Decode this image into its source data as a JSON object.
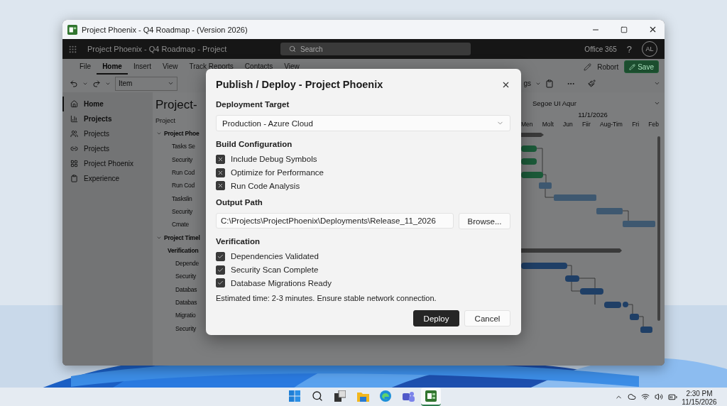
{
  "window": {
    "title": "Project Phoenix - Q4 Roadmap - (Version 2026)"
  },
  "app_bar": {
    "title": "Project Phoenix - Q4 Roadmap - Project",
    "search": {
      "placeholder": "Search"
    },
    "product": "Office 365",
    "help": "?",
    "avatar": "AL"
  },
  "ribbon": {
    "tabs": [
      {
        "label": "File",
        "selected": false
      },
      {
        "label": "Home",
        "selected": true
      },
      {
        "label": "Insert",
        "selected": false
      },
      {
        "label": "View",
        "selected": false
      },
      {
        "label": "Track Reports",
        "selected": false
      },
      {
        "label": "Contacts",
        "selected": false
      },
      {
        "label": "View",
        "selected": false
      }
    ],
    "user": "Robort",
    "save": "Save"
  },
  "toolbar": {
    "item_select": "Item",
    "partial_label": "gs",
    "font_select": "Segoe UI Aqur"
  },
  "sidebar": {
    "items": [
      {
        "label": "Home",
        "selected": true,
        "bold": true
      },
      {
        "label": "Projects",
        "selected": false,
        "bold": true
      },
      {
        "label": "Projects",
        "selected": false,
        "bold": false
      },
      {
        "label": "Projects",
        "selected": false,
        "bold": false
      },
      {
        "label": "Project Phoenix",
        "selected": false,
        "bold": false
      },
      {
        "label": "Experience",
        "selected": false,
        "bold": false
      }
    ]
  },
  "outline": {
    "title": "Project-",
    "column": "Project",
    "rows": [
      {
        "label": "Project Phoe",
        "expanded": true,
        "children": [
          {
            "label": "Tasks Se"
          },
          {
            "label": "Security"
          },
          {
            "label": "Run Cod"
          },
          {
            "label": "Run Cod"
          },
          {
            "label": "Taskslin"
          },
          {
            "label": "Security"
          },
          {
            "label": "Cmate"
          }
        ]
      },
      {
        "label": "Project Timel",
        "expanded": true,
        "children": [
          {
            "label": "Verification",
            "children": [
              {
                "label": "Depende"
              },
              {
                "label": "Security"
              },
              {
                "label": "Databas"
              },
              {
                "label": "Databas"
              },
              {
                "label": "Migratio"
              },
              {
                "label": "Security"
              }
            ]
          }
        ]
      }
    ]
  },
  "gantt": {
    "date": "11/1/2026",
    "periods": [
      "Men",
      "Molt",
      "Jun",
      "Fiir",
      "Aug-Tim",
      "Fri",
      "Feb"
    ]
  },
  "dialog": {
    "title": "Publish / Deploy - Project Phoenix",
    "target": {
      "label": "Deployment Target",
      "value": "Production - Azure Cloud"
    },
    "build": {
      "label": "Build Configuration",
      "options": [
        {
          "label": "Include Debug Symbols",
          "checked": true,
          "kind": "cross"
        },
        {
          "label": "Optimize for Performance",
          "checked": true,
          "kind": "cross"
        },
        {
          "label": "Run Code Analysis",
          "checked": true,
          "kind": "cross"
        }
      ]
    },
    "output": {
      "label": "Output Path",
      "value": "C:\\Projects\\ProjectPhoenix\\Deployments\\Release_11_2026",
      "browse": "Browse..."
    },
    "verification": {
      "label": "Verification",
      "options": [
        {
          "label": "Dependencies Validated",
          "checked": true,
          "kind": "tick"
        },
        {
          "label": "Security Scan Complete",
          "checked": true,
          "kind": "tick"
        },
        {
          "label": "Database Migrations Ready",
          "checked": true,
          "kind": "tick"
        }
      ]
    },
    "note": "Estimated time: 2-3 minutes. Ensure stable network connection.",
    "buttons": [
      {
        "label": "Deploy",
        "kind": "primary"
      },
      {
        "label": "Cancel",
        "kind": "secondary"
      }
    ]
  },
  "taskbar": {
    "apps": [
      {
        "kind": "start",
        "selected": false
      },
      {
        "kind": "search",
        "selected": false
      },
      {
        "kind": "taskview",
        "selected": false
      },
      {
        "kind": "folder",
        "selected": false
      },
      {
        "kind": "browser",
        "selected": false
      },
      {
        "kind": "chat",
        "selected": false
      },
      {
        "kind": "project",
        "selected": true
      }
    ],
    "time": "2:30 PM",
    "date": "11/15/2026"
  }
}
